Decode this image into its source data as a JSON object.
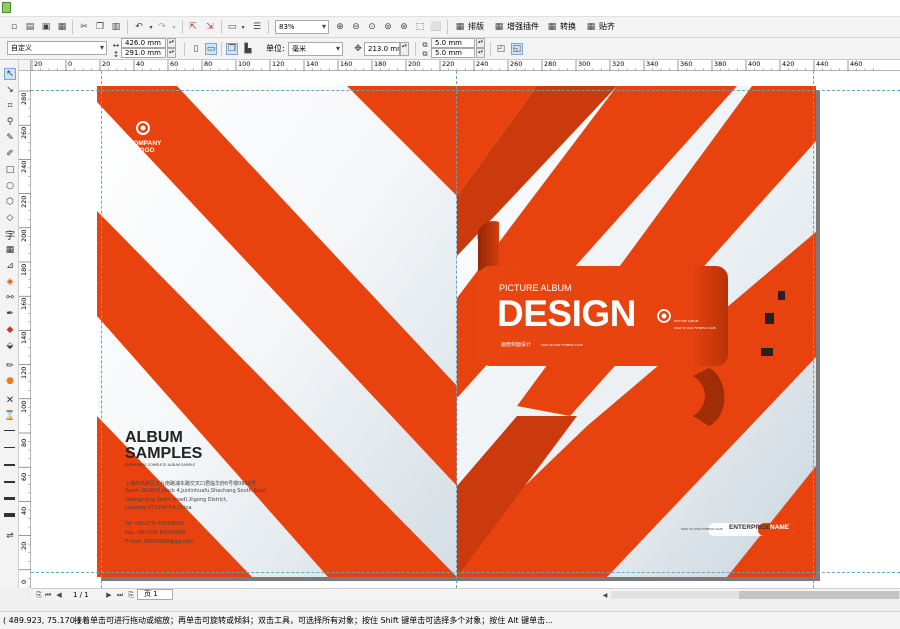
{
  "toolbar": {
    "zoom": "83%",
    "menu_items": [
      "排版",
      "增强插件",
      "转换",
      "贴齐"
    ]
  },
  "propertybar": {
    "preset": "自定义",
    "width": "426.0 mm",
    "height": "291.0 mm",
    "unit_label": "单位:",
    "unit": "毫米",
    "nudge": "213.0 mm",
    "dup_x": "5.0 mm",
    "dup_y": "5.0 mm"
  },
  "ruler": {
    "h_labels": [
      "20",
      "0",
      "20",
      "40",
      "60",
      "80",
      "100",
      "120",
      "140",
      "160",
      "180",
      "200",
      "220",
      "240",
      "260",
      "280",
      "300",
      "320",
      "340",
      "360",
      "380",
      "400",
      "420",
      "440",
      "460"
    ],
    "v_labels": [
      "280",
      "260",
      "240",
      "220",
      "200",
      "180",
      "160",
      "140",
      "120",
      "100",
      "80",
      "60",
      "40",
      "20",
      "0"
    ]
  },
  "artwork": {
    "company_logo": "COMPANY\nLOGO",
    "picture_album": "PICTURE ALBUM",
    "design": "DESIGN",
    "design_sub": "画册封面设计",
    "design_small": "ONLY IN OUR FITNESS CLUB",
    "logo_small_1": "PICTURE ALBUM",
    "logo_small_2": "ONLY IN OUR FITNESS CLUB",
    "album_title_1": "ALBUM",
    "album_title_2": "SAMPLES",
    "album_sub": "ENTERPRISE COMPLETE ALBUM SAMPLE",
    "address_cn": "上海市高新区天九南路浦东路交叉口君临华府6号楼0800号",
    "address_1": "Room 2K2803,block 4,Junlinhuafu,Shachang South Road",
    "address_2": "(Wangfujing South Road),Xigong District,",
    "address_3": "Luoyang 471000,P.R.China",
    "tel": "Tel: (86-379) 63000000",
    "fax": "Fax: (86-379) 63000000",
    "email": "E-mail: 00000000@qq.com",
    "enterprise": "ENTERPRISE",
    "name": "NAME",
    "tiny_tag": "ONLY IN OUR FITNESS CLUB"
  },
  "pagenav": {
    "count": "1 / 1",
    "tab": "页 1"
  },
  "status": {
    "coords": "( 489.923, 75.170 )",
    "hint": "接着单击可进行拖动或缩放；再单击可旋转或倾斜；双击工具，可选择所有对象；按住 Shift 键单击可选择多个对象；按住 Alt 键单击..."
  },
  "colors": {
    "orange": "#e8430f",
    "dark_orange": "#c93a0d"
  }
}
